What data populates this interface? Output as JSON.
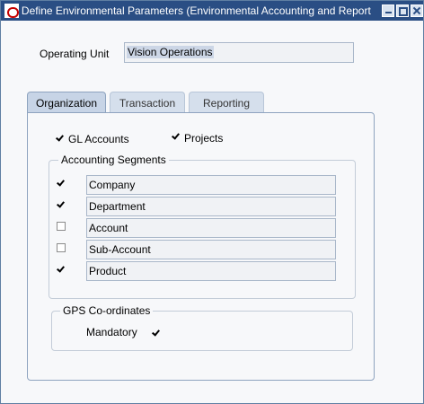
{
  "window": {
    "title": "Define Environmental Parameters (Environmental Accounting and Report",
    "buttons": [
      "minimize-icon",
      "maximize-icon",
      "close-icon"
    ]
  },
  "header": {
    "operating_unit_label": "Operating Unit",
    "operating_unit_value": "Vision Operations"
  },
  "tabs": [
    {
      "label": "Organization",
      "active": true
    },
    {
      "label": "Transaction",
      "active": false
    },
    {
      "label": "Reporting",
      "active": false
    }
  ],
  "organization": {
    "gl_accounts": {
      "label": "GL Accounts",
      "checked": true
    },
    "projects": {
      "label": "Projects",
      "checked": true
    },
    "accounting_segments": {
      "title": "Accounting Segments",
      "items": [
        {
          "label": "Company",
          "checked": true
        },
        {
          "label": "Department",
          "checked": true
        },
        {
          "label": "Account",
          "checked": false
        },
        {
          "label": "Sub-Account",
          "checked": false
        },
        {
          "label": "Product",
          "checked": true
        }
      ]
    },
    "gps": {
      "title": "GPS Co-ordinates",
      "mandatory_label": "Mandatory",
      "mandatory_checked": true
    }
  },
  "colors": {
    "titlebar": "#2a4e84",
    "tab_active": "#c7d4e6",
    "selection": "#ccd6e6"
  }
}
